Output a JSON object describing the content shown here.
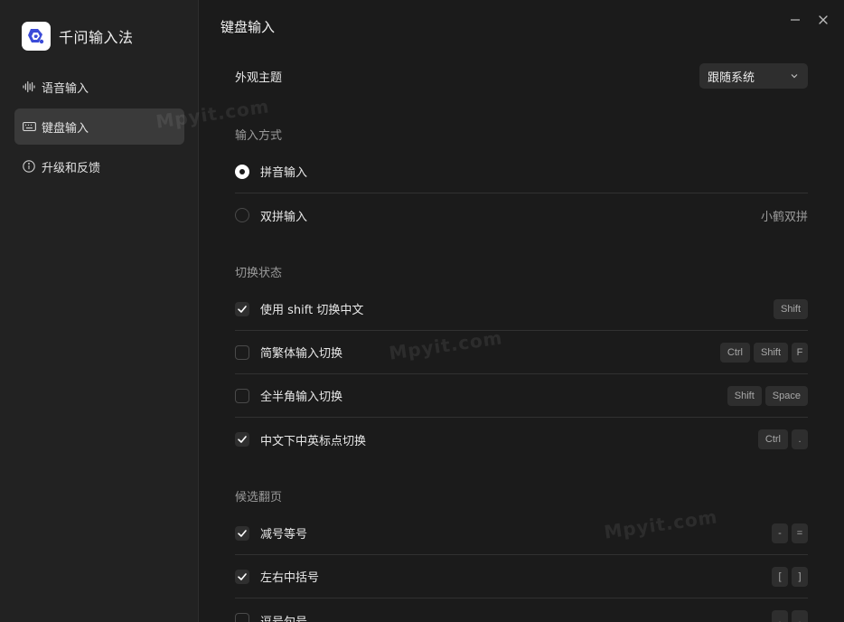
{
  "app": {
    "name": "千问输入法"
  },
  "sidebar": {
    "items": [
      {
        "label": "语音输入",
        "icon": "waveform-icon",
        "active": false
      },
      {
        "label": "键盘输入",
        "icon": "keyboard-icon",
        "active": true
      },
      {
        "label": "升级和反馈",
        "icon": "info-icon",
        "active": false
      }
    ]
  },
  "main": {
    "title": "键盘输入",
    "appearance": {
      "label": "外观主题",
      "value": "跟随系统"
    },
    "input_method": {
      "title": "输入方式",
      "options": [
        {
          "label": "拼音输入",
          "selected": true
        },
        {
          "label": "双拼输入",
          "selected": false,
          "detail": "小鹤双拼"
        }
      ]
    },
    "switch_state": {
      "title": "切换状态",
      "items": [
        {
          "label": "使用 shift 切换中文",
          "checked": true,
          "keys": [
            "Shift"
          ]
        },
        {
          "label": "简繁体输入切换",
          "checked": false,
          "keys": [
            "Ctrl",
            "Shift",
            "F"
          ]
        },
        {
          "label": "全半角输入切换",
          "checked": false,
          "keys": [
            "Shift",
            "Space"
          ]
        },
        {
          "label": "中文下中英标点切换",
          "checked": true,
          "keys": [
            "Ctrl",
            "."
          ]
        }
      ]
    },
    "paging": {
      "title": "候选翻页",
      "items": [
        {
          "label": "减号等号",
          "checked": true,
          "keys": [
            "-",
            "="
          ]
        },
        {
          "label": "左右中括号",
          "checked": true,
          "keys": [
            "[",
            "]"
          ]
        },
        {
          "label": "逗号句号",
          "checked": false,
          "keys": [
            ",",
            "."
          ]
        }
      ]
    }
  },
  "watermarks": [
    "Mpyit.com",
    "Mpyit.com",
    "Mpyit.com"
  ],
  "colors": {
    "background": "#1b1b1b",
    "sidebar": "#222222",
    "active_item": "#3a3a3a",
    "logo_accent": "#3b4bd8"
  }
}
